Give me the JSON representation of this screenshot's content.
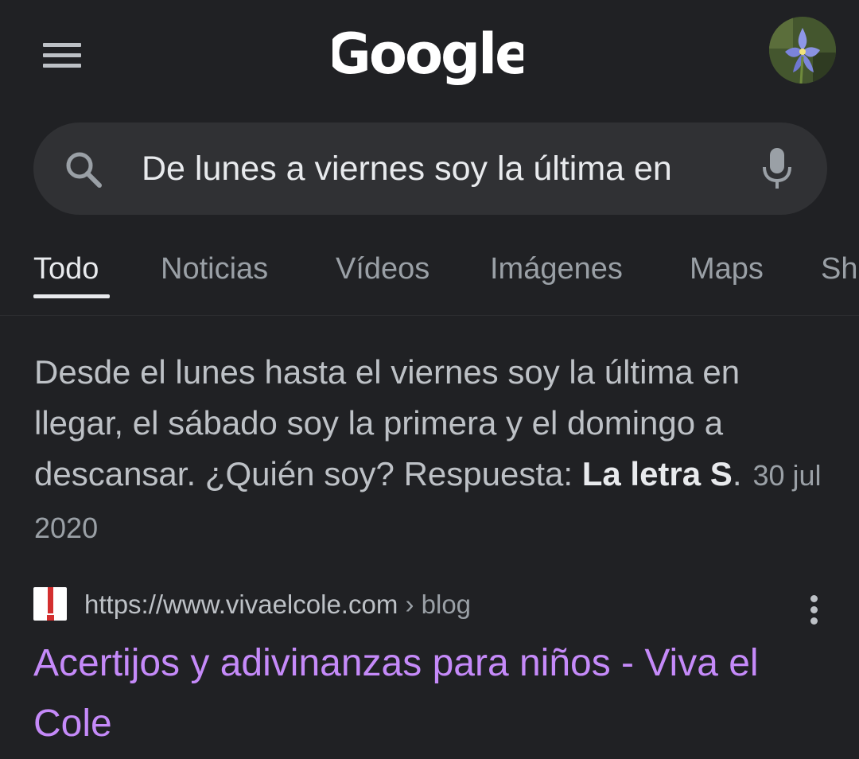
{
  "header": {
    "logo_text": "Google",
    "avatar_alt": "flower-avatar"
  },
  "search": {
    "query": "De lunes a viernes soy la última en"
  },
  "tabs": [
    {
      "label": "Todo",
      "active": true
    },
    {
      "label": "Noticias",
      "active": false
    },
    {
      "label": "Vídeos",
      "active": false
    },
    {
      "label": "Imágenes",
      "active": false
    },
    {
      "label": "Maps",
      "active": false
    },
    {
      "label": "Sh",
      "active": false
    }
  ],
  "featured_snippet": {
    "text": "Desde el lunes hasta el viernes soy la última en llegar, el sábado soy la primera y el domingo a descansar. ¿Quién soy? Respuesta: ",
    "answer": "La letra S",
    "answer_suffix": ".",
    "date": "30 jul 2020"
  },
  "result": {
    "url": "https://www.vivaelcole.com",
    "breadcrumb": " › blog",
    "title": "Acertijos y adivinanzas para niños - Viva el Cole"
  },
  "colors": {
    "background": "#202124",
    "searchbox": "#303134",
    "visited_link": "#c58af9",
    "text_primary": "#e8eaed",
    "text_secondary": "#bdc1c6"
  },
  "icons": {
    "menu": "hamburger-menu-icon",
    "search": "search-icon",
    "mic": "microphone-icon",
    "more": "more-vert-icon",
    "favicon": "site-favicon"
  }
}
